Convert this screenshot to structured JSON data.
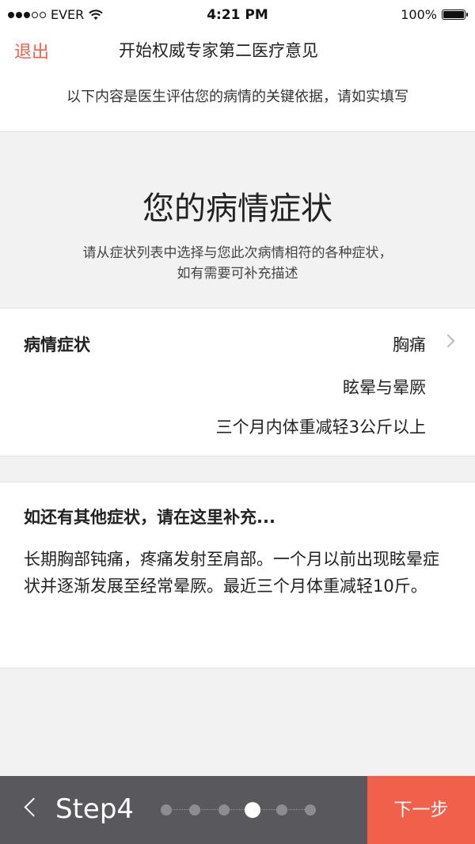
{
  "status_bar": {
    "carrier": "EVER",
    "time": "4:21 PM",
    "battery": "100%"
  },
  "nav": {
    "exit_label": "退出",
    "title": "开始权威专家第二医疗意见"
  },
  "subheader": "以下内容是医生评估您的病情的关键依据，请如实填写",
  "hero": {
    "title": "您的病情症状",
    "desc_line1": "请从症状列表中选择与您此次病情相符的各种症状，",
    "desc_line2": "如有需要可补充描述"
  },
  "symptoms": {
    "label": "病情症状",
    "items": [
      "胸痛",
      "眩晕与晕厥",
      "三个月内体重减轻3公斤以上"
    ]
  },
  "extra": {
    "prompt": "如还有其他症状，请在这里补充...",
    "value": "长期胸部钝痛，疼痛发射至肩部。一个月以前出现眩晕症状并逐渐发展至经常晕厥。最近三个月体重减轻10斤。"
  },
  "footer": {
    "step_label": "Step4",
    "total_steps": 6,
    "current_step": 4,
    "next_label": "下一步"
  },
  "colors": {
    "accent": "#f0604a",
    "footer_bg": "#58585d"
  }
}
